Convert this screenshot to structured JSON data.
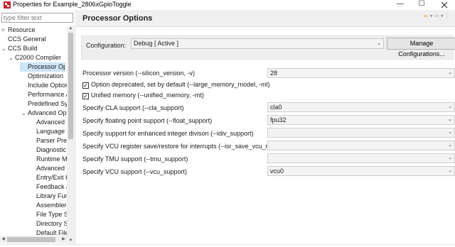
{
  "window": {
    "title": "Properties for Example_2806xGpioToggle",
    "minimize_glyph": "—",
    "maximize_glyph": "☐",
    "accent_color": "#c8202a"
  },
  "sidebar": {
    "filter_placeholder": "type filter text",
    "items": [
      {
        "label": "Resource",
        "expander": ">"
      },
      {
        "label": "CCS General",
        "expander": ""
      },
      {
        "label": "CCS Build",
        "expander": "⌄"
      },
      {
        "label": "C2000 Compiler",
        "expander": "⌄"
      },
      {
        "label": "Processor Opt",
        "expander": ""
      },
      {
        "label": "Optimization",
        "expander": ""
      },
      {
        "label": "Include Option",
        "expander": ""
      },
      {
        "label": "Performance A",
        "expander": ""
      },
      {
        "label": "Predefined Syr",
        "expander": ""
      },
      {
        "label": "Advanced Opt",
        "expander": "⌄"
      },
      {
        "label": "Advanced D",
        "expander": ""
      },
      {
        "label": "Language C",
        "expander": ""
      },
      {
        "label": "Parser Prep",
        "expander": ""
      },
      {
        "label": "Diagnostic",
        "expander": ""
      },
      {
        "label": "Runtime M",
        "expander": ""
      },
      {
        "label": "Advanced C",
        "expander": ""
      },
      {
        "label": "Entry/Exit H",
        "expander": ""
      },
      {
        "label": "Feedback a",
        "expander": ""
      },
      {
        "label": "Library Fun",
        "expander": ""
      },
      {
        "label": "Assembler",
        "expander": ""
      },
      {
        "label": "File Type Sp",
        "expander": ""
      },
      {
        "label": "Directory S",
        "expander": ""
      },
      {
        "label": "Default File",
        "expander": ""
      }
    ],
    "selected_index": 4
  },
  "page": {
    "title": "Processor Options",
    "nav_icons": [
      "back-arrow-icon",
      "dropdown-icon",
      "forward-arrow-icon",
      "dropdown-icon",
      "menu-icon"
    ]
  },
  "configuration": {
    "label": "Configuration:",
    "value": "Debug  [ Active ]",
    "manage_button": "Manage Configurations..."
  },
  "options": [
    {
      "label": "Processor version (--silicon_version, -v)",
      "value": "28"
    },
    {
      "label": "Specify CLA support (--cla_support)",
      "value": "cla0"
    },
    {
      "label": "Specify floating point support (--float_support)",
      "value": "fpu32"
    },
    {
      "label": "Specify support for enhanced integer divison (--idiv_support)",
      "value": ""
    },
    {
      "label": "Specify VCU register save/restore for interrupts (--isr_save_vcu_regs)",
      "value": ""
    },
    {
      "label": "Specify TMU support (--tmu_support)",
      "value": ""
    },
    {
      "label": "Specify VCU support (--vcu_support)",
      "value": "vcu0"
    }
  ],
  "checkboxes": [
    {
      "label": "Option deprecated, set by default (--large_memory_model, -ml)",
      "checked": true
    },
    {
      "label": "Unified memory (--unified_memory, -mt)",
      "checked": true
    }
  ]
}
